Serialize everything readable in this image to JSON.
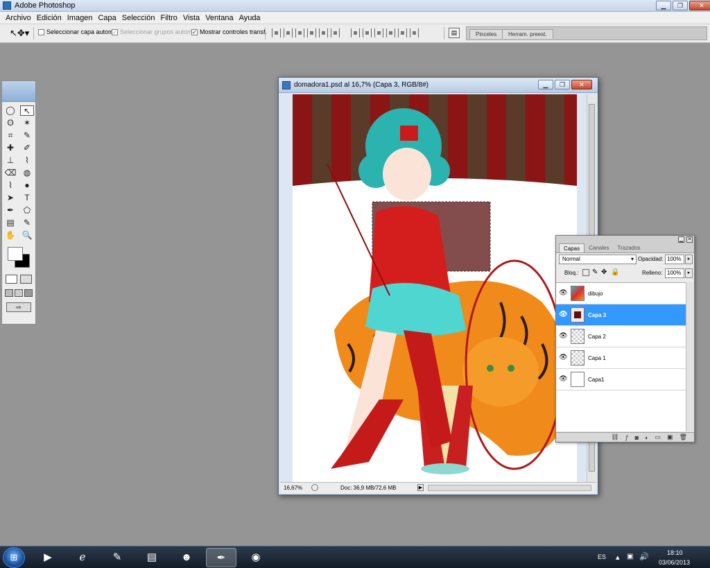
{
  "window": {
    "title": "Adobe Photoshop",
    "btn_min": "▁",
    "btn_max": "❐",
    "btn_close": "✕"
  },
  "menubar": {
    "items": [
      "Archivo",
      "Edición",
      "Imagen",
      "Capa",
      "Selección",
      "Filtro",
      "Vista",
      "Ventana",
      "Ayuda"
    ]
  },
  "options": {
    "auto_select_layer": "Seleccionar capa autom.",
    "auto_select_groups": "Seleccionar grupos autom.",
    "show_transform": "Mostrar controles transf.",
    "brushes_tab": "Pinceles",
    "presets_tab": "Herram. preest."
  },
  "toolbox": {
    "tools": [
      "◯",
      "↖",
      "ʘ",
      "✶",
      "⌗",
      "✎",
      "✚",
      "✐",
      "⊥",
      "⌇",
      "⌫",
      "◍",
      "⌇",
      "●",
      "➤",
      "T",
      "✒",
      "⬠",
      "▤",
      "✎",
      "✋",
      "🔍"
    ]
  },
  "document": {
    "title": "domadora1.psd al 16,7% (Capa 3, RGB/8#)",
    "zoom": "16,67%",
    "doc_info": "Doc: 36,9 MB/72,6 MB",
    "arrow": "▶"
  },
  "layers_panel": {
    "tabs": [
      "Capas",
      "Canales",
      "Trazados"
    ],
    "blend_mode": "Normal",
    "opacity_label": "Opacidad:",
    "opacity_value": "100%",
    "lock_label": "Bloq.:",
    "fill_label": "Relleno:",
    "fill_value": "100%",
    "layers": [
      {
        "name": "dibujo"
      },
      {
        "name": "Capa 3"
      },
      {
        "name": "Capa 2"
      },
      {
        "name": "Capa 1"
      },
      {
        "name": "Capa1"
      }
    ]
  },
  "taskbar": {
    "start": "⊞",
    "lang": "ES",
    "time": "18:10",
    "date": "03/06/2013"
  }
}
